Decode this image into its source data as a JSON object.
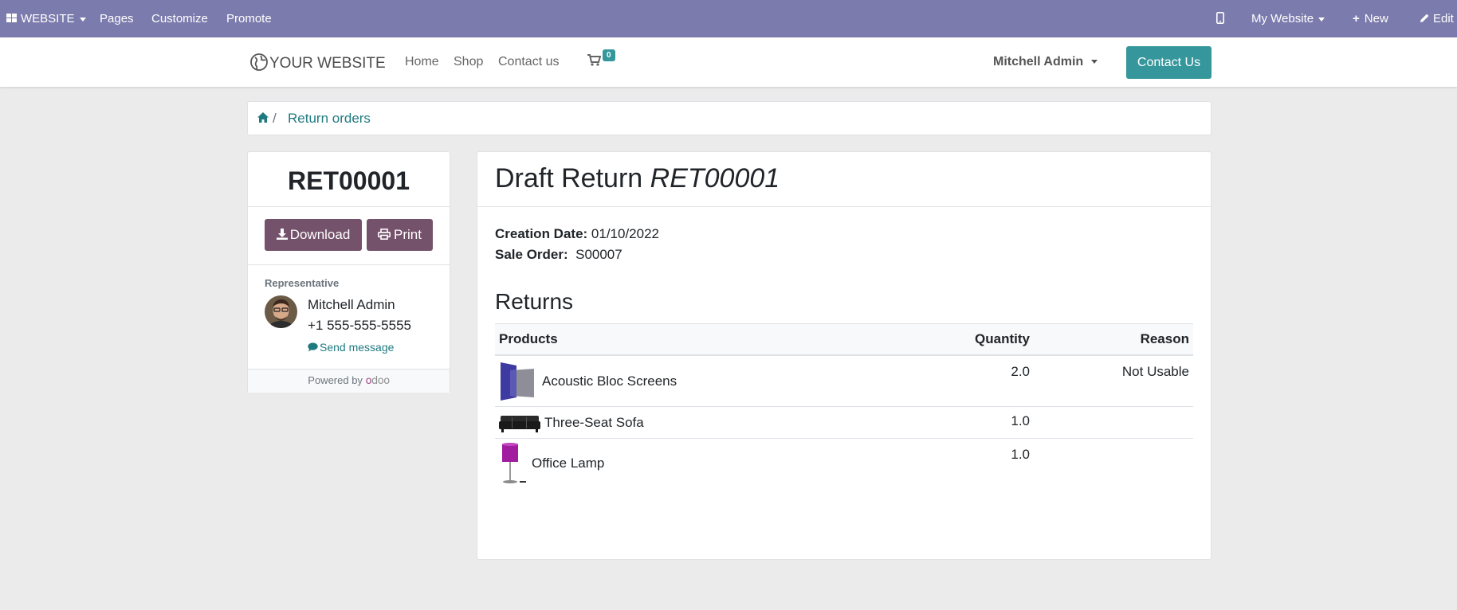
{
  "adminbar": {
    "website_menu": "WEBSITE",
    "pages": "Pages",
    "customize": "Customize",
    "promote": "Promote",
    "my_website": "My Website",
    "new": "New",
    "edit": "Edit"
  },
  "header": {
    "logo": "YOUR WEBSITE",
    "nav": [
      "Home",
      "Shop",
      "Contact us"
    ],
    "cart_count": "0",
    "user": "Mitchell Admin",
    "contact_btn": "Contact Us"
  },
  "breadcrumb": {
    "item": "Return orders"
  },
  "sidebar": {
    "name": "RET00001",
    "download": "Download",
    "print": "Print",
    "rep_label": "Representative",
    "rep_name": "Mitchell Admin",
    "rep_phone": "+1 555-555-5555",
    "send_message": "Send message",
    "powered_by": "Powered by",
    "brand": "odoo"
  },
  "main": {
    "title_prefix": "Draft Return",
    "title_ref": "RET00001",
    "creation_label": "Creation Date:",
    "creation_value": "01/10/2022",
    "sale_label": "Sale Order:",
    "sale_value": "S00007",
    "returns_heading": "Returns",
    "columns": [
      "Products",
      "Quantity",
      "Reason"
    ],
    "rows": [
      {
        "product": "Acoustic Bloc Screens",
        "qty": "2.0",
        "reason": "Not Usable"
      },
      {
        "product": "Three-Seat Sofa",
        "qty": "1.0",
        "reason": ""
      },
      {
        "product": "Office Lamp",
        "qty": "1.0",
        "reason": ""
      }
    ]
  },
  "colors": {
    "adminbar": "#7c7bad",
    "accent": "#35979c",
    "button": "#75526b"
  }
}
